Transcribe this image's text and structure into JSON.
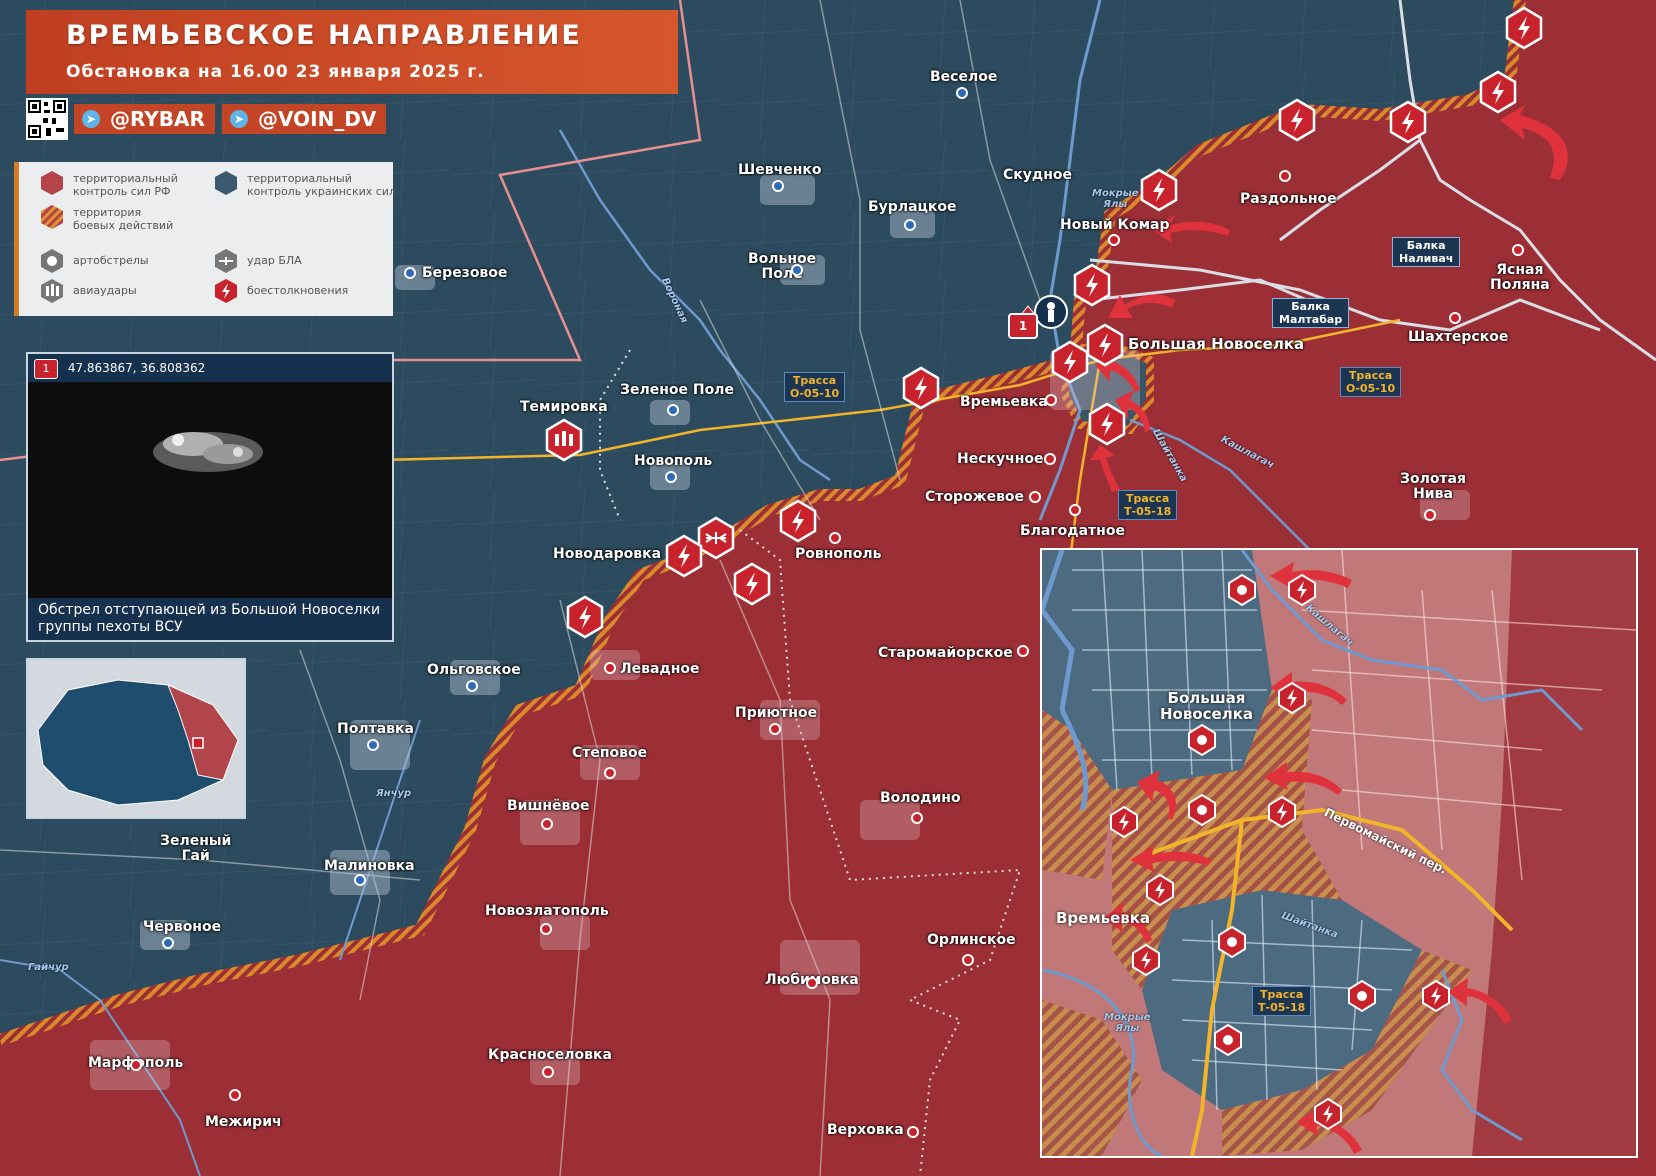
{
  "header": {
    "title": "ВРЕМЬЕВСКОЕ НАПРАВЛЕНИЕ",
    "subtitle": "Обстановка на 16.00 23 января 2025 г."
  },
  "socials": {
    "primary": "@RYBAR",
    "secondary": "@VOIN_DV"
  },
  "legend": {
    "ru_control": "территориальный\nконтроль сил РФ",
    "ua_control": "территориальный\nконтроль украинских сил",
    "combat_zone": "территория\nбоевых действий",
    "artillery": "артобстрелы",
    "drone_strike": "удар БЛА",
    "air_strike": "авиаудары",
    "clashes": "боестолкновения"
  },
  "photo": {
    "marker": "1",
    "coords": "47.863867, 36.808362",
    "caption": "Обстрел отступающей из Большой Новоселки группы пехоты ВСУ"
  },
  "map_marker": "1",
  "settlements": {
    "veseloe": "Веселое",
    "shevchenko": "Шевченко",
    "skudnoe": "Скудное",
    "burlatskoe": "Бурлацкое",
    "razdolnoe": "Раздольное",
    "novy_komar": "Новый Комар",
    "volnoe_pole": "Вольное\nПоле",
    "berezovoe": "Березовое",
    "yasnaya_polyana": "Ясная\nПоляна",
    "bolshaya_novoselka": "Большая Новоселка",
    "shakhterskoe": "Шахтерское",
    "temirovka": "Темировка",
    "zelenoe_pole": "Зеленое Поле",
    "vremyevka": "Времьевка",
    "novopol": "Новополь",
    "neskuchnoe": "Нескучное",
    "storozhevoe": "Сторожевое",
    "blagodatnoe": "Благодатное",
    "zolotaya_niva": "Золотая\nНива",
    "novodarovka": "Новодаровка",
    "rovnopol": "Ровнополь",
    "olgovskoe": "Ольговское",
    "levadnoe": "Левадное",
    "staromayorskoe": "Старомайорское",
    "priyutnoe": "Приютное",
    "poltavka": "Полтавка",
    "stepovoe": "Степовое",
    "vishnevoe": "Вишнёвое",
    "volodino": "Володино",
    "zeleny_gai": "Зеленый\nГай",
    "malinovka": "Малиновка",
    "chervonoe": "Червоное",
    "novozlatopol": "Новозлатополь",
    "orlinskoe": "Орлинское",
    "lyubimovka": "Любимовка",
    "marfopol": "Марфополь",
    "krasnoselovka": "Красноселовка",
    "mezhirich": "Межирич",
    "verkhovka": "Верховка"
  },
  "roads": {
    "o0510_a": "Трасса\nО-05-10",
    "o0510_b": "Трасса\nО-05-10",
    "t0518": "Трасса\nТ-05-18"
  },
  "rivers": {
    "voronaya": "Воронaя",
    "mokrye_yaly": "Мокрые\nЯлы",
    "shaitanka": "Шайтанка",
    "kashlagach": "Кашлагач",
    "yanchur": "Янчур",
    "gaichur": "Гайчур"
  },
  "balkas": {
    "nalivach": "Балка\nНаливач",
    "maltabar": "Балка\nМалтабар"
  },
  "inset": {
    "bolshaya_novoselka": "Большая\nНовоселка",
    "vremyevka": "Времьевка",
    "road": "Трасса\nТ-05-18",
    "street": "Первомайский пер.",
    "shaitanka": "Шайтанка",
    "kashlagach": "Кашлагач",
    "mokrye_yaly": "Мокрые\nЯлы"
  },
  "colors": {
    "ru_control": "#9c2f36",
    "ua_control": "#2d4b5e",
    "combat_stripe": "#d98a2a",
    "marker_red": "#c8232c",
    "header_orange": "#d4512a",
    "road_yellow": "#f2b52a"
  }
}
